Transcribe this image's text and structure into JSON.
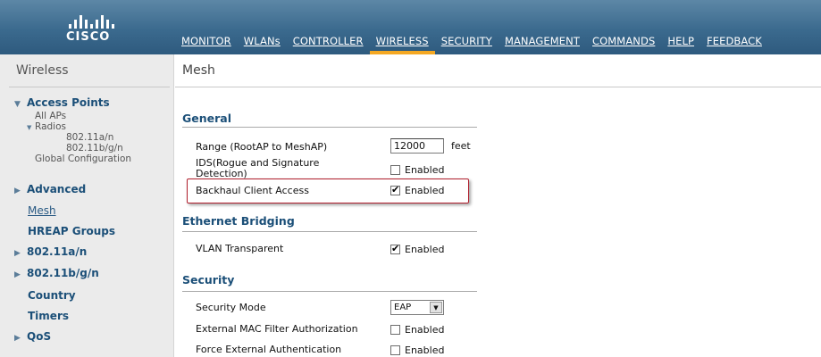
{
  "brand": {
    "name": "CISCO"
  },
  "nav": [
    "MONITOR",
    "WLANs",
    "CONTROLLER",
    "WIRELESS",
    "SECURITY",
    "MANAGEMENT",
    "COMMANDS",
    "HELP",
    "FEEDBACK"
  ],
  "nav_active": "WIRELESS",
  "sidebar": {
    "title": "Wireless",
    "access_points": "Access Points",
    "all_aps": "All APs",
    "radios": "Radios",
    "radio_a": "802.11a/n",
    "radio_bg": "802.11b/g/n",
    "global_config": "Global Configuration",
    "advanced": "Advanced",
    "mesh": "Mesh",
    "hreap": "HREAP Groups",
    "n_a": "802.11a/n",
    "n_bg": "802.11b/g/n",
    "country": "Country",
    "timers": "Timers",
    "qos": "QoS"
  },
  "main": {
    "title": "Mesh",
    "general": {
      "heading": "General",
      "range_label": "Range (RootAP to MeshAP)",
      "range_value": "12000",
      "range_unit": "feet",
      "ids_label_1": "IDS(Rogue and Signature",
      "ids_label_2": "Detection)",
      "ids_value": "Enabled",
      "ids_checked": false,
      "backhaul_label": "Backhaul Client Access",
      "backhaul_value": "Enabled",
      "backhaul_checked": true
    },
    "ethernet": {
      "heading": "Ethernet Bridging",
      "vlan_label": "VLAN Transparent",
      "vlan_value": "Enabled",
      "vlan_checked": true
    },
    "security": {
      "heading": "Security",
      "mode_label": "Security Mode",
      "mode_value": "EAP",
      "mac_label": "External MAC Filter Authorization",
      "mac_value": "Enabled",
      "mac_checked": false,
      "force_label": "Force External Authentication",
      "force_value": "Enabled",
      "force_checked": false
    }
  },
  "colors": {
    "header": "#3b6a8e",
    "active_tab": "#f4a823",
    "link": "#1b4f78",
    "highlight": "#b01e2c"
  }
}
